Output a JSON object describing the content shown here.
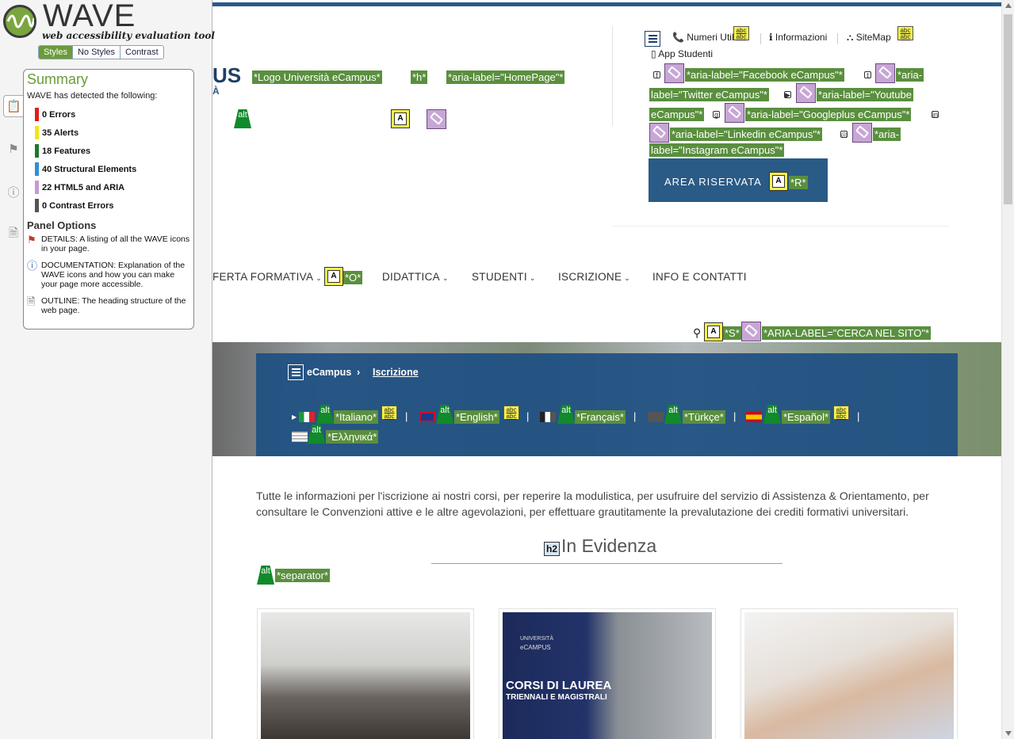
{
  "wave": {
    "logo_name": "WAVE",
    "logo_tagline": "web accessibility evaluation tool",
    "style_toggles": [
      "Styles",
      "No Styles",
      "Contrast"
    ],
    "summary_title": "Summary",
    "detected_text": "WAVE has detected the following:",
    "summary": [
      {
        "label": "0 Errors",
        "color": "#e21b1b"
      },
      {
        "label": "35 Alerts",
        "color": "#f2e417"
      },
      {
        "label": "18 Features",
        "color": "#1a7a2a"
      },
      {
        "label": "40 Structural Elements",
        "color": "#2f8fd6"
      },
      {
        "label": "22 HTML5 and ARIA",
        "color": "#c89ad6"
      },
      {
        "label": "0 Contrast Errors",
        "color": "#555555"
      }
    ],
    "panel_options_title": "Panel Options",
    "options": [
      {
        "icon": "flag-icon",
        "text": "DETAILS: A listing of all the WAVE icons in your page."
      },
      {
        "icon": "info-icon",
        "text": "DOCUMENTATION: Explanation of the WAVE icons and how you can make your page more accessible."
      },
      {
        "icon": "outline-icon",
        "text": "OUTLINE: The heading structure of the web page."
      }
    ]
  },
  "header": {
    "logo_fragment": "US",
    "logo_sub": "À",
    "logo_labels": [
      "*Logo Università eCampus*",
      "*h*",
      "*aria-label=\"HomePage\"*"
    ],
    "top_links": [
      "Numeri Utili",
      "Informazioni",
      "SiteMap",
      "App Studenti"
    ],
    "social_labels": [
      "*aria-label=\"Facebook eCampus\"*",
      "*aria-",
      "label=\"Twitter eCampus\"*",
      "*aria-label=\"Youtube",
      "eCampus\"*",
      "*aria-label=\"Googleplus eCampus\"*",
      "*aria-label=\"Linkedin eCampus\"*",
      "*aria-",
      "label=\"Instagram eCampus\"*"
    ],
    "area_button": "AREA RISERVATA",
    "area_label": "*R*",
    "abc_top": "abc",
    "abc_bottom": "abc",
    "a_letter": "A",
    "alt_text": "alt"
  },
  "menu": {
    "items": [
      "FERTA FORMATIVA",
      "DIDATTICA",
      "STUDENTI",
      "ISCRIZIONE",
      "INFO E CONTATTI"
    ],
    "offerta_label": "*O*",
    "chevron": "⌄",
    "search_labels": [
      "*S*",
      "*ARIA-LABEL=\"CERCA NEL SITO\"*"
    ]
  },
  "breadcrumb": {
    "home": "eCampus",
    "separator": "›",
    "current": "Iscrizione"
  },
  "languages": [
    {
      "label": "*Italiano*"
    },
    {
      "label": "*English*"
    },
    {
      "label": "*Français*"
    },
    {
      "label": "*Türkçe*"
    },
    {
      "label": "*Español*"
    },
    {
      "label": "*Ελληνικά*"
    }
  ],
  "lang_separator": "|",
  "content": {
    "intro": "Tutte le informazioni per l'iscrizione ai nostri corsi, per reperire la modulistica, per usufruire del servizio di Assistenza & Orientamento, per consultare le Convenzioni attive e le altre agevolazioni, per effettuare grautitamente la prevalutazione dei crediti formativi universitari.",
    "h2_badge": "h2",
    "heading": "In Evidenza",
    "separator_label": "*separator*",
    "card2_text": [
      "UNIVERSITÀ",
      "eCAMPUS",
      "CORSI DI LAUREA",
      "TRIENNALI E MAGISTRALI"
    ]
  }
}
